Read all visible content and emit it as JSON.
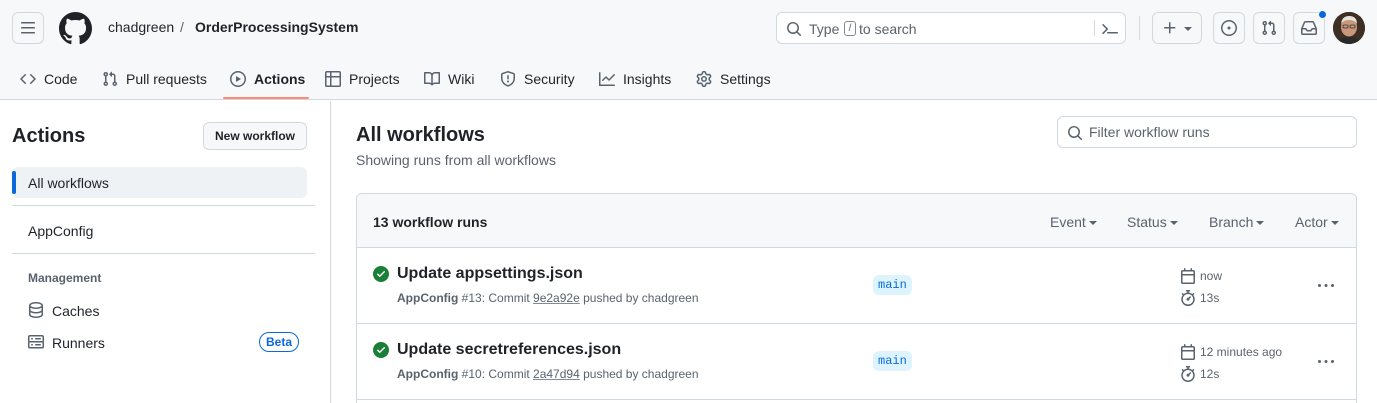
{
  "header": {
    "owner": "chadgreen",
    "separator": "/",
    "repo": "OrderProcessingSystem",
    "search": {
      "prefix": "Type",
      "kbd": "/",
      "suffix": "to search"
    },
    "icons": [
      "menu-icon",
      "github-logo-icon",
      "search-icon",
      "command-palette-icon",
      "plus-icon",
      "issues-icon",
      "pull-requests-icon",
      "inbox-icon"
    ],
    "notification_color": "#0969da"
  },
  "tabs": [
    {
      "label": "Code",
      "icon": "code-icon"
    },
    {
      "label": "Pull requests",
      "icon": "git-pull-request-icon"
    },
    {
      "label": "Actions",
      "icon": "play-icon",
      "active": true
    },
    {
      "label": "Projects",
      "icon": "table-icon"
    },
    {
      "label": "Wiki",
      "icon": "book-icon"
    },
    {
      "label": "Security",
      "icon": "shield-icon"
    },
    {
      "label": "Insights",
      "icon": "graph-icon"
    },
    {
      "label": "Settings",
      "icon": "gear-icon"
    }
  ],
  "active_tab_color": "#fd8c73",
  "sidebar": {
    "title": "Actions",
    "new_workflow_label": "New workflow",
    "all_workflows_label": "All workflows",
    "workflows": [
      "AppConfig"
    ],
    "management_heading": "Management",
    "caches_label": "Caches",
    "runners_label": "Runners",
    "beta_label": "Beta"
  },
  "main": {
    "title": "All workflows",
    "subtitle": "Showing runs from all workflows",
    "filter_placeholder": "Filter workflow runs",
    "runs_count": "13 workflow runs",
    "filters": {
      "event": "Event",
      "status": "Status",
      "branch": "Branch",
      "actor": "Actor"
    },
    "runs": [
      {
        "title": "Update appsettings.json",
        "workflow": "AppConfig",
        "run_number": "#13",
        "commit_prefix": ": Commit",
        "commit": "9e2a92e",
        "pushed_by": "pushed by chadgreen",
        "branch": "main",
        "when": "now",
        "duration": "13s",
        "status": "success"
      },
      {
        "title": "Update secretreferences.json",
        "workflow": "AppConfig",
        "run_number": "#10",
        "commit_prefix": ": Commit",
        "commit": "2a47d94",
        "pushed_by": "pushed by chadgreen",
        "branch": "main",
        "when": "12 minutes ago",
        "duration": "12s",
        "status": "success"
      }
    ],
    "success_color": "#1a7f37",
    "branch_color": "#0969da"
  }
}
